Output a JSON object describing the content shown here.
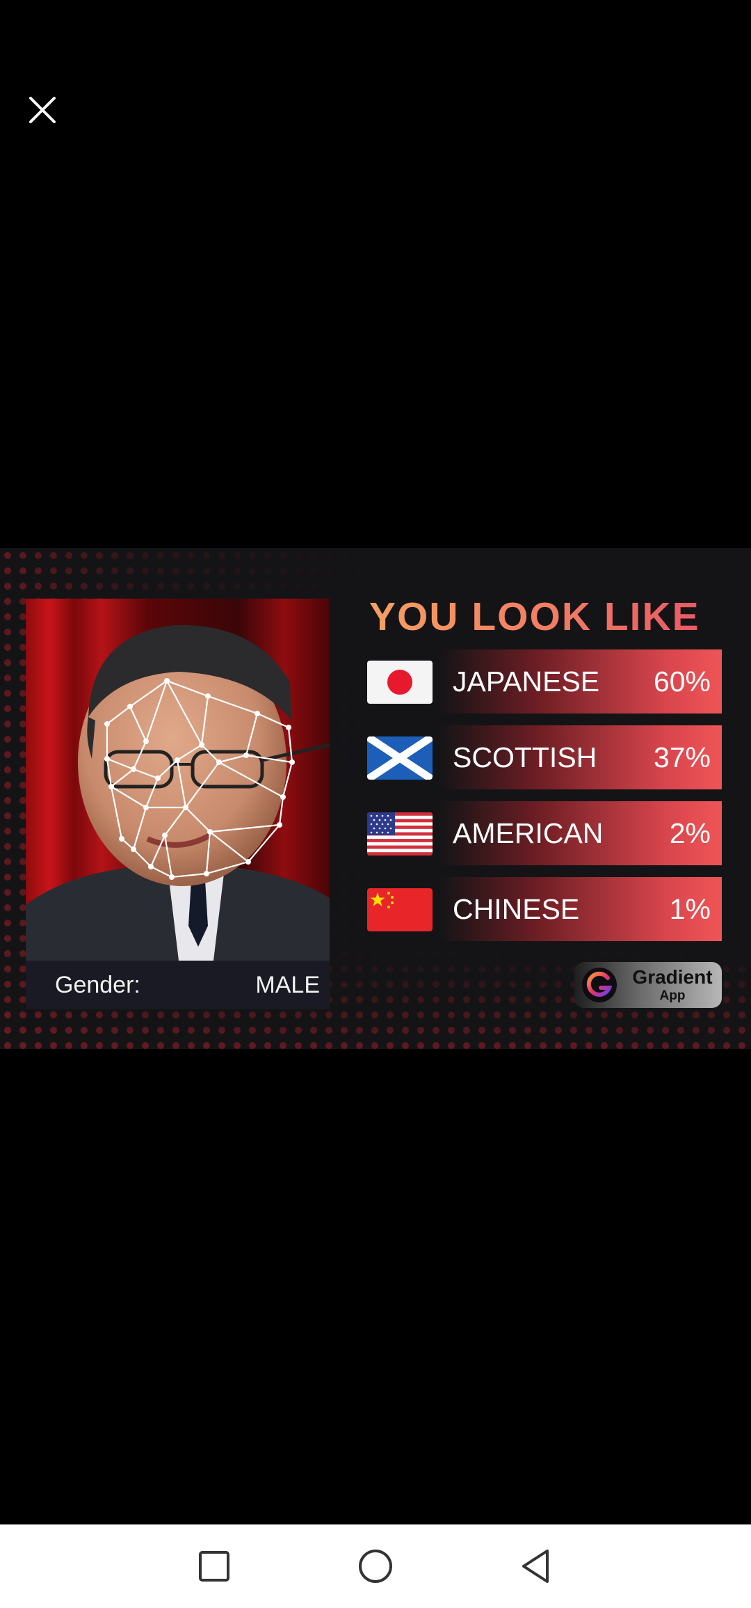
{
  "header": {
    "close_icon": "close-icon"
  },
  "result_card": {
    "headline": "YOU LOOK LIKE",
    "gender_label": "Gender:",
    "gender_value": "MALE",
    "results": [
      {
        "flag": "japan-flag-icon",
        "label": "JAPANESE",
        "percent": "60%"
      },
      {
        "flag": "scotland-flag-icon",
        "label": "SCOTTISH",
        "percent": "37%"
      },
      {
        "flag": "usa-flag-icon",
        "label": "AMERICAN",
        "percent": "2%"
      },
      {
        "flag": "china-flag-icon",
        "label": "CHINESE",
        "percent": "1%"
      }
    ],
    "brand": {
      "name": "Gradient",
      "sub": "App",
      "logo": "gradient-logo-icon"
    },
    "colors": {
      "headline_start": "#f6a062",
      "headline_end": "#ea5364",
      "bar_end": "#ef5556"
    }
  },
  "system_nav": {
    "recents_icon": "square-icon",
    "home_icon": "circle-icon",
    "back_icon": "triangle-back-icon"
  }
}
